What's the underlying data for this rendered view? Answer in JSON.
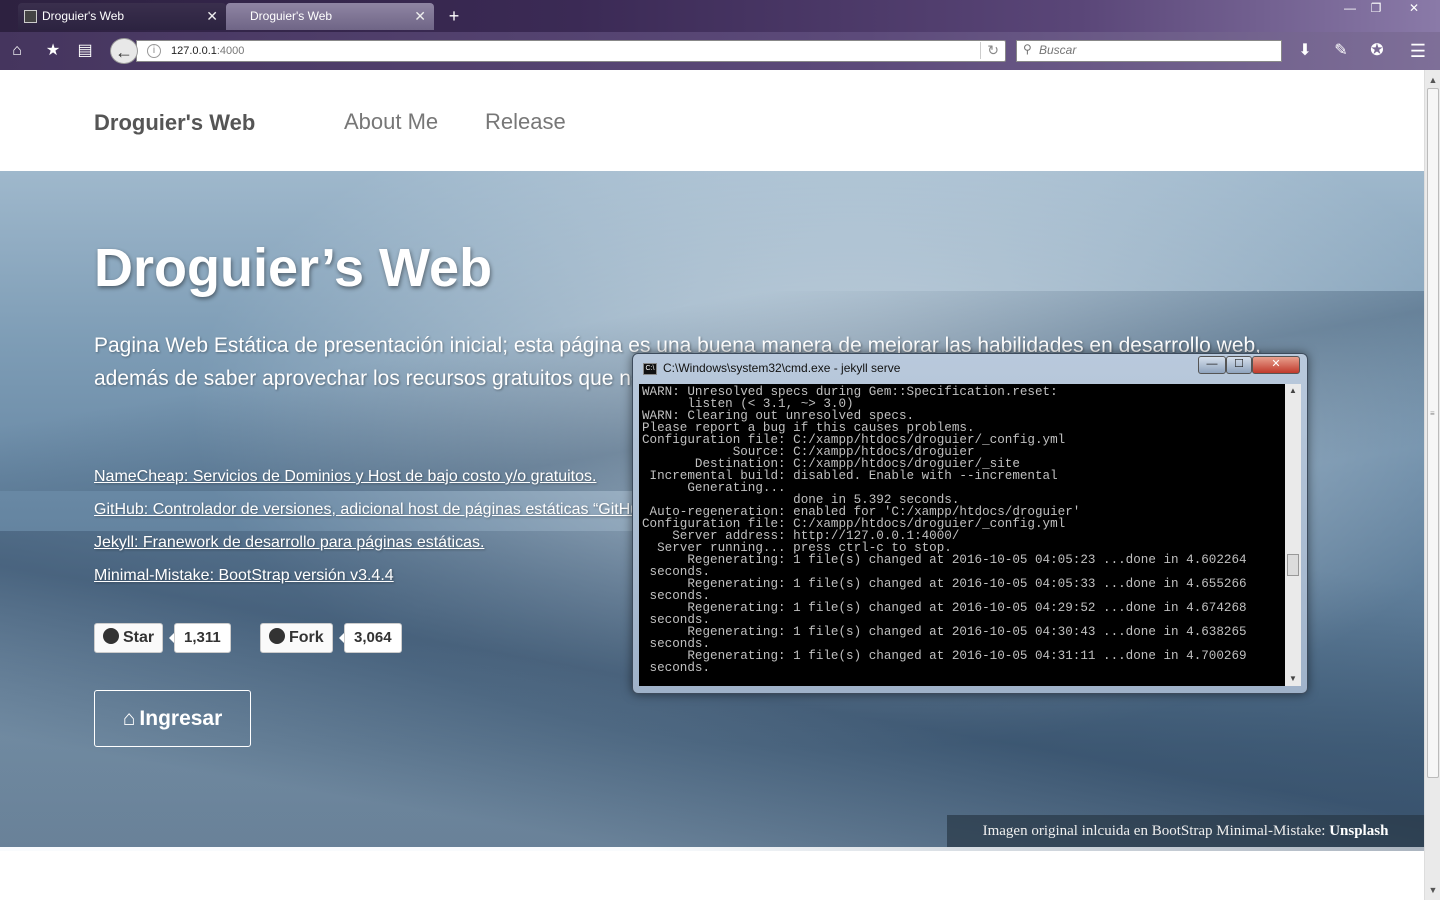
{
  "browser": {
    "tabs": [
      {
        "title": "Droguier's Web",
        "active": false
      },
      {
        "title": "Droguier's Web",
        "active": true
      }
    ],
    "new_tab_glyph": "+",
    "url_host": "127.0.0.1",
    "url_port": ":4000",
    "search_placeholder": "Buscar",
    "nav_icons": [
      "home-icon",
      "bookmark-star-icon",
      "reading-list-icon",
      "back-arrow-icon",
      "site-info-icon",
      "reload-icon",
      "download-icon",
      "tools-icon",
      "addons-icon",
      "menu-icon"
    ]
  },
  "site": {
    "brand": "Droguier's Web",
    "nav": {
      "about": "About Me",
      "release": "Release"
    },
    "hero": {
      "title": "Droguier’s Web",
      "description": "Pagina Web Estática de presentación inicial; esta página es una buena manera de mejorar las habilidades en desarrollo web, además de saber aprovechar los recursos gratuitos que nos ofrecen: NameCheap, GitHub, Jekyll y BootStrap Minimal-Mistake.",
      "links": [
        "NameCheap: Servicios de Dominios y Host de bajo costo y/o gratuitos.",
        "GitHub: Controlador de versiones, adicional host de páginas estáticas “GitHub Pages”.",
        "Jekyll: Franework de desarrollo para páginas estáticas.",
        "Minimal-Mistake: BootStrap versión v3.4.4"
      ],
      "star_label": "Star",
      "star_count": "1,311",
      "fork_label": "Fork",
      "fork_count": "3,064",
      "enter_label": "Ingresar",
      "credit_text": "Imagen original inlcuida en BootStrap Minimal-Mistake: ",
      "credit_link": "Unsplash"
    }
  },
  "console": {
    "title": "C:\\Windows\\system32\\cmd.exe - jekyll  serve",
    "output": "WARN: Unresolved specs during Gem::Specification.reset:\n      listen (< 3.1, ~> 3.0)\nWARN: Clearing out unresolved specs.\nPlease report a bug if this causes problems.\nConfiguration file: C:/xampp/htdocs/droguier/_config.yml\n            Source: C:/xampp/htdocs/droguier\n       Destination: C:/xampp/htdocs/droguier/_site\n Incremental build: disabled. Enable with --incremental\n      Generating...\n                    done in 5.392 seconds.\n Auto-regeneration: enabled for 'C:/xampp/htdocs/droguier'\nConfiguration file: C:/xampp/htdocs/droguier/_config.yml\n    Server address: http://127.0.0.1:4000/\n  Server running... press ctrl-c to stop.\n      Regenerating: 1 file(s) changed at 2016-10-05 04:05:23 ...done in 4.602264\n seconds.\n      Regenerating: 1 file(s) changed at 2016-10-05 04:05:33 ...done in 4.655266\n seconds.\n      Regenerating: 1 file(s) changed at 2016-10-05 04:29:52 ...done in 4.674268\n seconds.\n      Regenerating: 1 file(s) changed at 2016-10-05 04:30:43 ...done in 4.638265\n seconds.\n      Regenerating: 1 file(s) changed at 2016-10-05 04:31:11 ...done in 4.700269\n seconds."
  },
  "colors": {
    "chrome_purple": "#45355e",
    "brand_gray": "#555555",
    "nav_gray": "#777777",
    "hero_blue": "#6a8aa6",
    "console_bg": "#000000",
    "console_fg": "#c0c0c0"
  }
}
